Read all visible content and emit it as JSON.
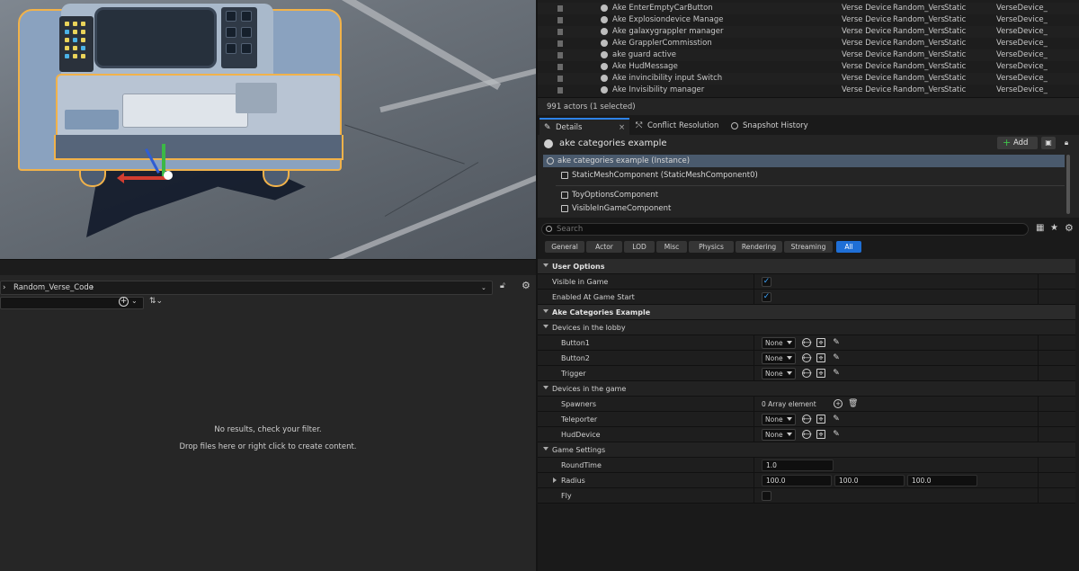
{
  "outliner": {
    "rows": [
      {
        "name": "Ake EnterEmptyCarButton",
        "type": "Verse Device",
        "folder": "Random_Vers",
        "mobility": "Static",
        "class": "VerseDevice_"
      },
      {
        "name": "Ake Explosiondevice Manage",
        "type": "Verse Device",
        "folder": "Random_Vers",
        "mobility": "Static",
        "class": "VerseDevice_"
      },
      {
        "name": "Ake galaxygrappler manager",
        "type": "Verse Device",
        "folder": "Random_Vers",
        "mobility": "Static",
        "class": "VerseDevice_"
      },
      {
        "name": "Ake GrapplerCommisstion",
        "type": "Verse Device",
        "folder": "Random_Vers",
        "mobility": "Static",
        "class": "VerseDevice_"
      },
      {
        "name": "ake guard active",
        "type": "Verse Device",
        "folder": "Random_Vers",
        "mobility": "Static",
        "class": "VerseDevice_"
      },
      {
        "name": "Ake HudMessage",
        "type": "Verse Device",
        "folder": "Random_Vers",
        "mobility": "Static",
        "class": "VerseDevice_"
      },
      {
        "name": "Ake invincibility input Switch",
        "type": "Verse Device",
        "folder": "Random_Vers",
        "mobility": "Static",
        "class": "VerseDevice_"
      },
      {
        "name": "Ake Invisibility manager",
        "type": "Verse Device",
        "folder": "Random_Vers",
        "mobility": "Static",
        "class": "VerseDevice_"
      }
    ],
    "status": "991 actors (1 selected)"
  },
  "tabs": {
    "details": "Details",
    "conflict": "Conflict Resolution",
    "snapshot": "Snapshot History"
  },
  "details": {
    "actor_title": "ake categories example",
    "add_label": "Add",
    "components": [
      "ake categories example (Instance)",
      "StaticMeshComponent (StaticMeshComponent0)",
      "ToyOptionsComponent",
      "VisibleInGameComponent"
    ],
    "search_placeholder": "Search",
    "categories": [
      "General",
      "Actor",
      "LOD",
      "Misc",
      "Physics",
      "Rendering",
      "Streaming",
      "All"
    ],
    "sections": {
      "user_options": "User Options",
      "visible_in_game": "Visible in Game",
      "enabled_at_start": "Enabled At Game Start",
      "ake_categories": "Ake Categories Example",
      "lobby": "Devices in the lobby",
      "button1": "Button1",
      "button2": "Button2",
      "trigger": "Trigger",
      "ingame": "Devices in the game",
      "spawners": "Spawners",
      "array_elements": "0 Array element",
      "teleporter": "Teleporter",
      "huddevice": "HudDevice",
      "game_settings": "Game Settings",
      "roundtime": "RoundTime",
      "roundtime_value": "1.0",
      "radius": "Radius",
      "radius_x": "100.0",
      "radius_y": "100.0",
      "radius_z": "100.0",
      "fly": "Fly",
      "none": "None"
    }
  },
  "content_browser": {
    "path": "Random_Verse_Code",
    "msg1": "No results, check your filter.",
    "msg2": "Drop files here or right click to create content."
  }
}
